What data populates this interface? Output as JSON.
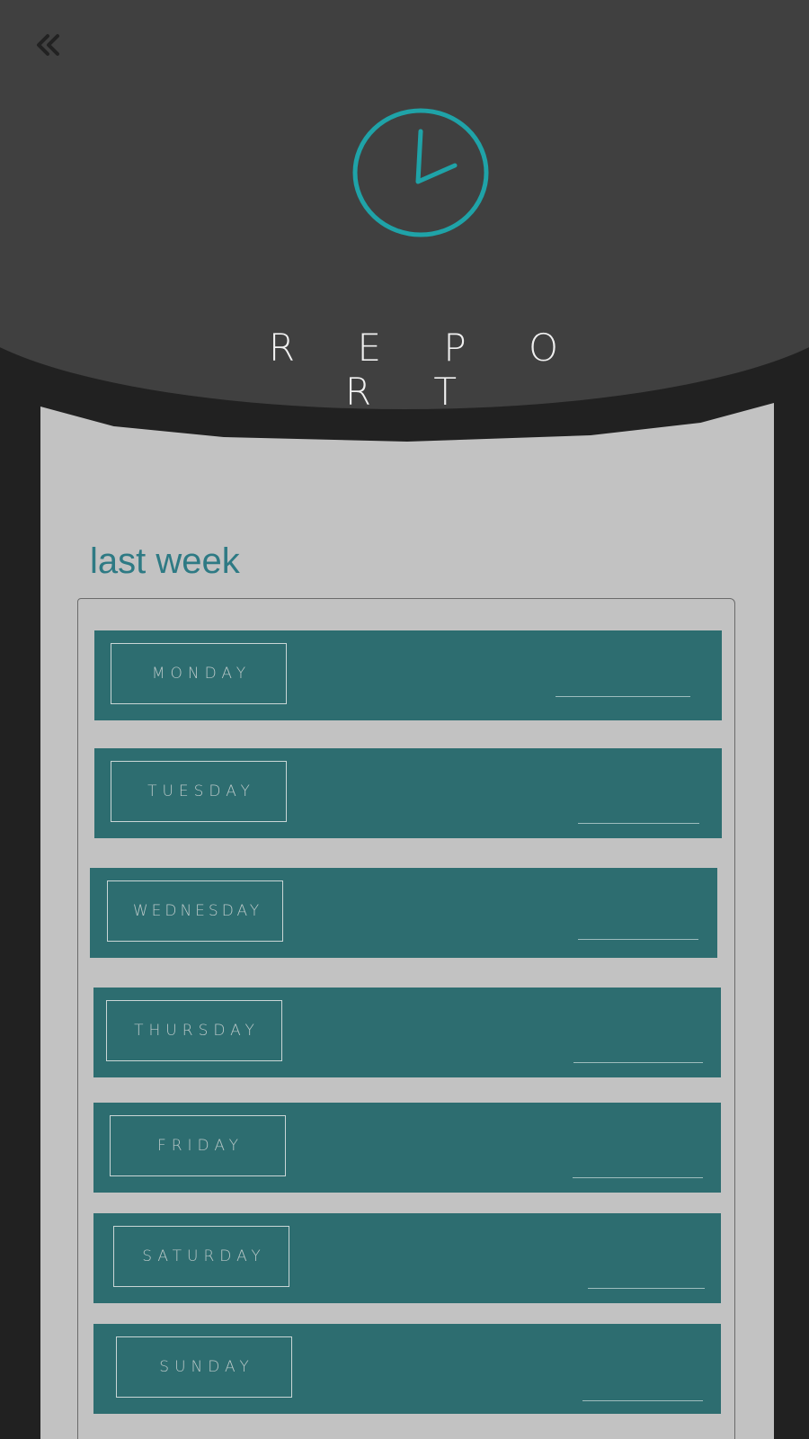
{
  "header": {
    "title": "R E P O R T",
    "back_icon": "double-chevron-left-icon",
    "clock_icon": "clock-icon"
  },
  "colors": {
    "header_bg": "#404040",
    "page_bg": "#212121",
    "card_bg": "#c2c2c2",
    "accent": "#2d6d70",
    "clock": "#1fa3a8",
    "section_title": "#2e7a84"
  },
  "section": {
    "title": "last week"
  },
  "days": [
    {
      "label": "MONDAY",
      "value": ""
    },
    {
      "label": "TUESDAY",
      "value": ""
    },
    {
      "label": "WEDNESDAY",
      "value": ""
    },
    {
      "label": "THURSDAY",
      "value": ""
    },
    {
      "label": "FRIDAY",
      "value": ""
    },
    {
      "label": "SATURDAY",
      "value": ""
    },
    {
      "label": "SUNDAY",
      "value": ""
    }
  ]
}
